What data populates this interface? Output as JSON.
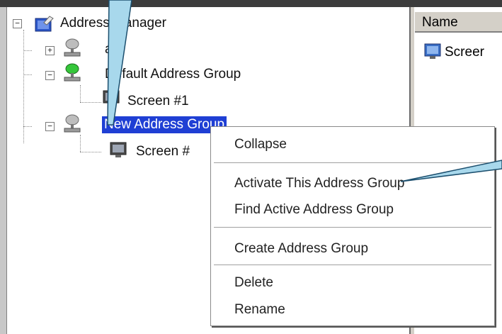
{
  "tree": {
    "root": {
      "label": "Address Manager",
      "expander": "−",
      "icon": "address-book-icon"
    },
    "nodes": [
      {
        "label": "a",
        "expander": "+",
        "icon": "computer-network-icon"
      },
      {
        "label": "Default Address Group",
        "expander": "−",
        "icon": "computer-network-active-icon",
        "children": [
          {
            "label": "Screen #1",
            "icon": "monitor-icon"
          }
        ]
      },
      {
        "label": "New Address Group",
        "expander": "−",
        "icon": "computer-network-icon",
        "selected": true,
        "children": [
          {
            "label": "Screen #",
            "icon": "monitor-icon"
          }
        ]
      }
    ]
  },
  "list": {
    "header": "Name",
    "rows": [
      {
        "label": "Screer",
        "icon": "monitor-icon"
      }
    ]
  },
  "context_menu": {
    "groups": [
      [
        "Collapse"
      ],
      [
        "Activate This Address Group",
        "Find Active Address Group"
      ],
      [
        "Create Address Group"
      ],
      [
        "Delete",
        "Rename"
      ]
    ]
  },
  "colors": {
    "selection": "#1f3fd4",
    "callout_fill": "#a8d8ec",
    "callout_stroke": "#1c4f6e"
  }
}
